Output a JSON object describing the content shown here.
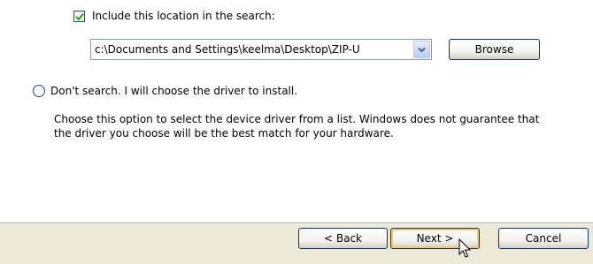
{
  "search_options": {
    "include_location_checked": true,
    "include_location_label": "Include this location in the search:",
    "location_path": "c:\\Documents and Settings\\keelma\\Desktop\\ZIP-U",
    "browse_label": "Browse"
  },
  "dont_search": {
    "selected": false,
    "label": "Don't search. I will choose the driver to install.",
    "description_lines": [
      "Choose this option to select the device driver from a list.  Windows does not guarantee that",
      "the driver you choose will be the best match for your hardware."
    ]
  },
  "navigation": {
    "back_label": "< Back",
    "next_label": "Next >",
    "cancel_label": "Cancel"
  },
  "colors": {
    "window_background": "#ece9d8",
    "content_background": "#ffffff",
    "button_border": "#003c74",
    "default_button_highlight": "#f7c768",
    "checkmark": "#21a121"
  }
}
